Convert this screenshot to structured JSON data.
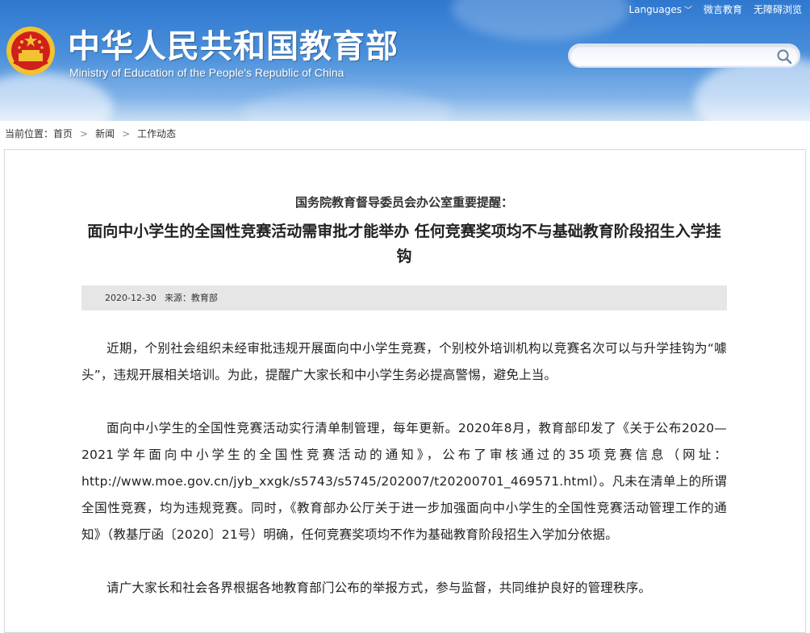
{
  "header": {
    "title": "中华人民共和国教育部",
    "subtitle": "Ministry of Education of the People's Republic of China",
    "links": {
      "languages": "Languages",
      "weibo": "微言教育",
      "accessibility": "无障碍浏览"
    },
    "search": {
      "placeholder": ""
    }
  },
  "breadcrumb": {
    "label": "当前位置：",
    "items": [
      "首页",
      "新闻",
      "工作动态"
    ]
  },
  "article": {
    "kicker": "国务院教育督导委员会办公室重要提醒：",
    "headline": "面向中小学生的全国性竞赛活动需审批才能举办 任何竞赛奖项均不与基础教育阶段招生入学挂钩",
    "meta": {
      "date": "2020-12-30",
      "source": "来源：教育部"
    },
    "paragraphs": [
      "近期，个别社会组织未经审批违规开展面向中小学生竞赛，个别校外培训机构以竞赛名次可以与升学挂钩为“噱头”，违规开展相关培训。为此，提醒广大家长和中小学生务必提高警惕，避免上当。",
      "面向中小学生的全国性竞赛活动实行清单制管理，每年更新。2020年8月，教育部印发了《关于公布2020—2021学年面向中小学生的全国性竞赛活动的通知》，公布了审核通过的35项竞赛信息（网址：http://www.moe.gov.cn/jyb_xxgk/s5743/s5745/202007/t20200701_469571.html）。凡未在清单上的所谓全国性竞赛，均为违规竞赛。同时，《教育部办公厅关于进一步加强面向中小学生的全国性竞赛活动管理工作的通知》（教基厅函〔2020〕21号）明确，任何竞赛奖项均不作为基础教育阶段招生入学加分依据。",
      "请广大家长和社会各界根据各地教育部门公布的举报方式，参与监督，共同维护良好的管理秩序。"
    ]
  },
  "colors": {
    "header_blue": "#2f78cf",
    "meta_bar_gray": "#e6e6e6",
    "emblem_red": "#d0201c",
    "emblem_gold": "#f2c230"
  }
}
